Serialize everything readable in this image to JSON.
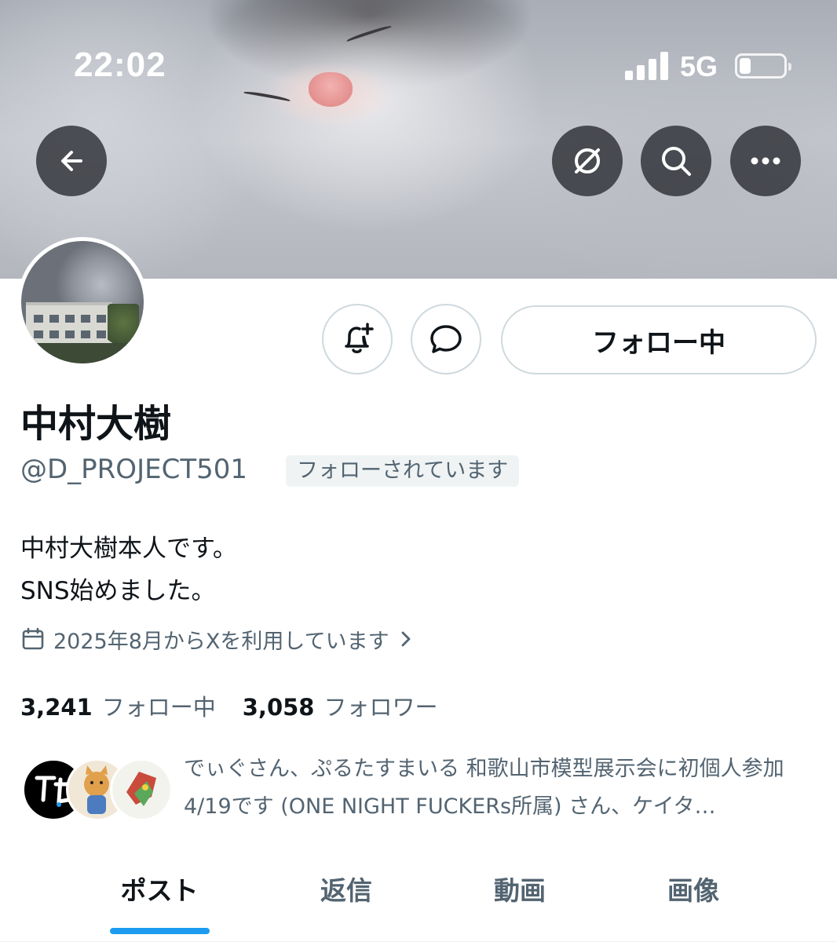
{
  "status_bar": {
    "time": "22:02",
    "network": "5G",
    "signal_bars": 4,
    "battery_level": 0.2
  },
  "header_actions": {
    "back_icon": "arrow-left-icon",
    "translate_icon": "grok-icon",
    "search_icon": "search-icon",
    "more_icon": "more-icon"
  },
  "actions": {
    "notify_icon": "bell-plus-icon",
    "message_icon": "message-bubble-icon",
    "follow_label": "フォロー中"
  },
  "profile": {
    "display_name": "中村大樹",
    "handle": "@D_PROJECT501",
    "follows_you_badge": "フォローされています",
    "bio_line1": "中村大樹本人です。",
    "bio_line2": "SNS始めました。",
    "joined": "2025年8月からXを利用しています"
  },
  "stats": {
    "following_count": "3,241",
    "following_label": "フォロー中",
    "followers_count": "3,058",
    "followers_label": "フォロワー"
  },
  "mutuals": {
    "text": "でぃぐさん、ぷるたすまいる 和歌山市模型展示会に初個人参加4/19です (ONE NIGHT FUCKERs所属) さん、ケイタ…"
  },
  "tabs": [
    {
      "label": "ポスト",
      "active": true
    },
    {
      "label": "返信",
      "active": false
    },
    {
      "label": "動画",
      "active": false
    },
    {
      "label": "画像",
      "active": false
    }
  ],
  "colors": {
    "accent": "#1d9bf0",
    "secondary_text": "#536471",
    "primary_text": "#0f1419"
  }
}
